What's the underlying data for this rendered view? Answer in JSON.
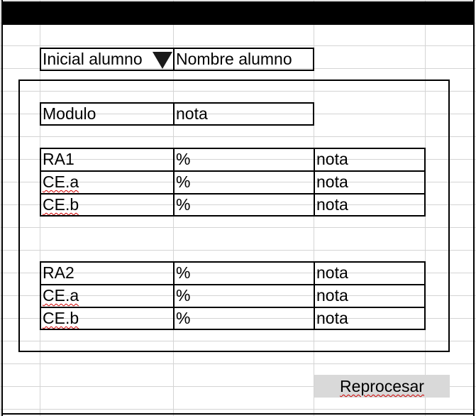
{
  "student": {
    "initial_label": "Inicial alumno",
    "name_label": "Nombre alumno"
  },
  "module": {
    "label": "Modulo",
    "grade": "nota"
  },
  "ra_groups": [
    {
      "rows": [
        {
          "name": "RA1",
          "percent": "%",
          "grade": "nota"
        },
        {
          "name": "CE.a",
          "percent": "%",
          "grade": "nota"
        },
        {
          "name": "CE.b",
          "percent": "%",
          "grade": "nota"
        }
      ]
    },
    {
      "rows": [
        {
          "name": "RA2",
          "percent": "%",
          "grade": "nota"
        },
        {
          "name": "CE.a",
          "percent": "%",
          "grade": "nota"
        },
        {
          "name": "CE.b",
          "percent": "%",
          "grade": "nota"
        }
      ]
    }
  ],
  "actions": {
    "reprocess_label": "Reprocesar"
  },
  "icons": {
    "dropdown": "dropdown-triangle-icon"
  },
  "colors": {
    "header_bar": "#000000",
    "gridline": "#d4d4d4",
    "button_bg": "#d9d9d9",
    "spellcheck": "#d00000"
  }
}
